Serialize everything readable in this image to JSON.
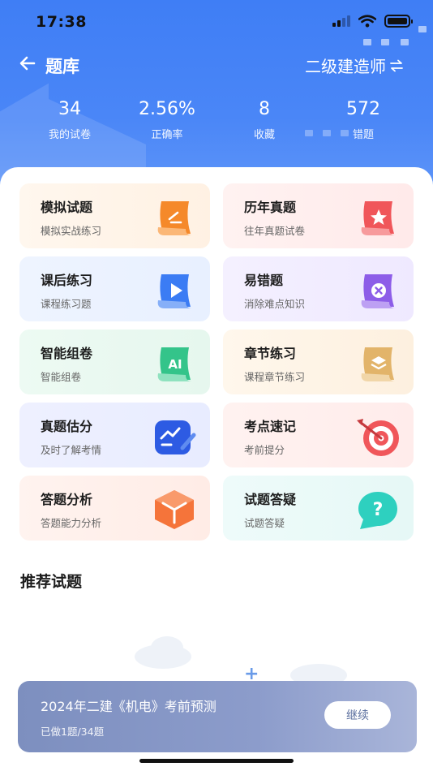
{
  "status": {
    "time": "17:38"
  },
  "nav": {
    "title": "题库",
    "exam_label": "二级建造师"
  },
  "stats": [
    {
      "value": "34",
      "label": "我的试卷"
    },
    {
      "value": "2.56%",
      "label": "正确率"
    },
    {
      "value": "8",
      "label": "收藏"
    },
    {
      "value": "572",
      "label": "错题"
    }
  ],
  "cards": [
    {
      "title": "模拟试题",
      "subtitle": "模拟实战练习",
      "icon": "pencil-scroll-icon"
    },
    {
      "title": "历年真题",
      "subtitle": "往年真题试卷",
      "icon": "star-scroll-icon"
    },
    {
      "title": "课后练习",
      "subtitle": "课程练习题",
      "icon": "play-scroll-icon"
    },
    {
      "title": "易错题",
      "subtitle": "消除难点知识",
      "icon": "x-scroll-icon"
    },
    {
      "title": "智能组卷",
      "subtitle": "智能组卷",
      "icon": "ai-scroll-icon",
      "icon_text": "AI"
    },
    {
      "title": "章节练习",
      "subtitle": "课程章节练习",
      "icon": "layers-scroll-icon"
    },
    {
      "title": "真题估分",
      "subtitle": "及时了解考情",
      "icon": "chart-pen-icon"
    },
    {
      "title": "考点速记",
      "subtitle": "考前提分",
      "icon": "target-icon"
    },
    {
      "title": "答题分析",
      "subtitle": "答题能力分析",
      "icon": "cube-icon"
    },
    {
      "title": "试题答疑",
      "subtitle": "试题答疑",
      "icon": "question-bubble-icon",
      "icon_text": "?"
    }
  ],
  "section": {
    "title": "推荐试题"
  },
  "banner": {
    "title": "2024年二建《机电》考前预测",
    "progress_text": "已做1题/34题",
    "button_label": "继续"
  },
  "colors": {
    "header_blue": "#4a86f7",
    "orange": "#f5892a",
    "red": "#f0565a",
    "blue": "#3b7cf4",
    "purple": "#8d5de8",
    "green": "#34c48a",
    "tan": "#e2b46a",
    "navy": "#2d5be3",
    "teal": "#2ed0bf"
  }
}
